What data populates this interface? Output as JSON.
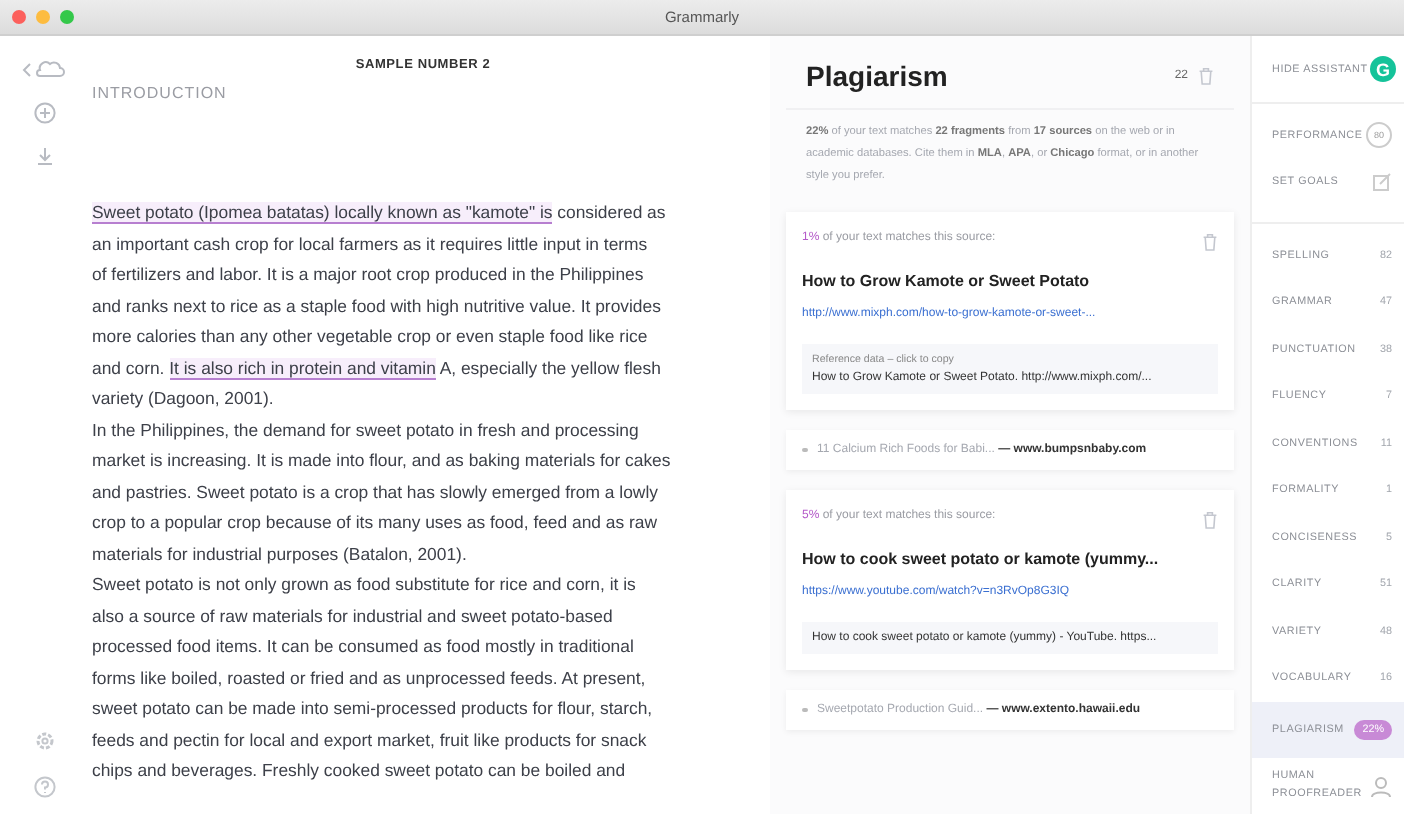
{
  "window": {
    "title": "Grammarly"
  },
  "document": {
    "title": "SAMPLE NUMBER 2",
    "heading": "INTRODUCTION",
    "paragraphs": [
      {
        "lines": [
          [
            {
              "text": "Sweet potato (Ipomea batatas) locally known as \"kamote\" is",
              "highlighted": true
            },
            {
              "text": " considered as",
              "highlighted": false
            }
          ],
          [
            {
              "text": "an important cash crop for local farmers as it requires little input in terms",
              "highlighted": false
            }
          ],
          [
            {
              "text": "of fertilizers and labor. It is a major root crop produced in the Philippines",
              "highlighted": false
            }
          ],
          [
            {
              "text": "and ranks next to rice as a staple food with high nutritive value. It provides",
              "highlighted": false
            }
          ],
          [
            {
              "text": "more calories than any other vegetable crop or even staple food like rice",
              "highlighted": false
            }
          ],
          [
            {
              "text": "and corn. ",
              "highlighted": false
            },
            {
              "text": "It is also rich in protein and vitamin",
              "highlighted": true
            },
            {
              "text": " A, especially the yellow flesh",
              "highlighted": false
            }
          ],
          [
            {
              "text": "variety (Dagoon, 2001).",
              "highlighted": false
            }
          ]
        ]
      },
      {
        "lines": [
          [
            {
              "text": "In the Philippines, the demand for sweet potato in fresh and processing",
              "highlighted": false
            }
          ],
          [
            {
              "text": "market is increasing. It is made into flour, and as baking materials for cakes",
              "highlighted": false
            }
          ],
          [
            {
              "text": "and pastries. Sweet potato is a crop that has slowly emerged from a lowly",
              "highlighted": false
            }
          ],
          [
            {
              "text": "crop to a popular crop because of its many uses as food, feed and as raw",
              "highlighted": false
            }
          ],
          [
            {
              "text": "materials for industrial purposes (Batalon, 2001).",
              "highlighted": false
            }
          ]
        ]
      },
      {
        "lines": [
          [
            {
              "text": "Sweet potato is not only grown as food substitute for rice and corn, it is",
              "highlighted": false
            }
          ],
          [
            {
              "text": "also a source of raw materials for industrial and sweet potato-based",
              "highlighted": false
            }
          ],
          [
            {
              "text": "processed food items. It can be consumed as food mostly in traditional",
              "highlighted": false
            }
          ],
          [
            {
              "text": "forms like boiled, roasted or fried and as unprocessed feeds. At present,",
              "highlighted": false
            }
          ],
          [
            {
              "text": "sweet potato can be made into semi-processed products for flour, starch,",
              "highlighted": false
            }
          ],
          [
            {
              "text": "feeds and pectin for local and export market, fruit like products for snack",
              "highlighted": false
            }
          ],
          [
            {
              "text": "chips and beverages. Freshly cooked sweet potato can be boiled and",
              "highlighted": false
            }
          ]
        ]
      }
    ]
  },
  "plagiarism": {
    "title": "Plagiarism",
    "count": "22",
    "summary": "**22%** of your text matches **22 fragments** from **17 sources** on the web or in academic databases. Cite them in **MLA**, **APA**, or **Chicago** format, or in another style you prefer.",
    "items": [
      {
        "kind": "card",
        "percent": "1%",
        "match_text": "of your text matches this source:",
        "title": "How to Grow Kamote or Sweet Potato",
        "url": "http://www.mixph.com/how-to-grow-kamote-or-sweet-...",
        "reference_label": "Reference data – click to copy",
        "reference": "How to Grow Kamote or Sweet Potato. http://www.mixph.com/..."
      },
      {
        "kind": "source",
        "title": "11 Calcium Rich Foods for Babi...",
        "site": "— www.bumpsnbaby.com"
      },
      {
        "kind": "card",
        "percent": "5%",
        "match_text": "of your text matches this source:",
        "title": "How to cook sweet potato or kamote (yummy...",
        "url": "https://www.youtube.com/watch?v=n3RvOp8G3IQ",
        "reference": "How to cook sweet potato or kamote (yummy) - YouTube. https..."
      },
      {
        "kind": "source",
        "title": "Sweetpotato Production Guid...",
        "site": "— www.extento.hawaii.edu"
      }
    ]
  },
  "assistant": {
    "hide_label": "HIDE ASSISTANT",
    "logo_letter": "G",
    "top_items": [
      {
        "kind": "score",
        "label": "PERFORMANCE",
        "value": "80"
      },
      {
        "kind": "goals",
        "label": "SET GOALS"
      }
    ],
    "categories": [
      {
        "label": "SPELLING",
        "count": "82"
      },
      {
        "label": "GRAMMAR",
        "count": "47"
      },
      {
        "label": "PUNCTUATION",
        "count": "38"
      },
      {
        "label": "FLUENCY",
        "count": "7"
      },
      {
        "label": "CONVENTIONS",
        "count": "11"
      },
      {
        "label": "FORMALITY",
        "count": "1"
      },
      {
        "label": "CONCISENESS",
        "count": "5"
      },
      {
        "label": "CLARITY",
        "count": "51"
      },
      {
        "label": "VARIETY",
        "count": "48"
      },
      {
        "label": "VOCABULARY",
        "count": "16"
      }
    ],
    "bottom_items": [
      {
        "kind": "badge",
        "label": "PLAGIARISM",
        "value": "22%",
        "selected": true
      },
      {
        "kind": "person",
        "label": "HUMAN PROOFREADER",
        "selected": false
      }
    ]
  }
}
